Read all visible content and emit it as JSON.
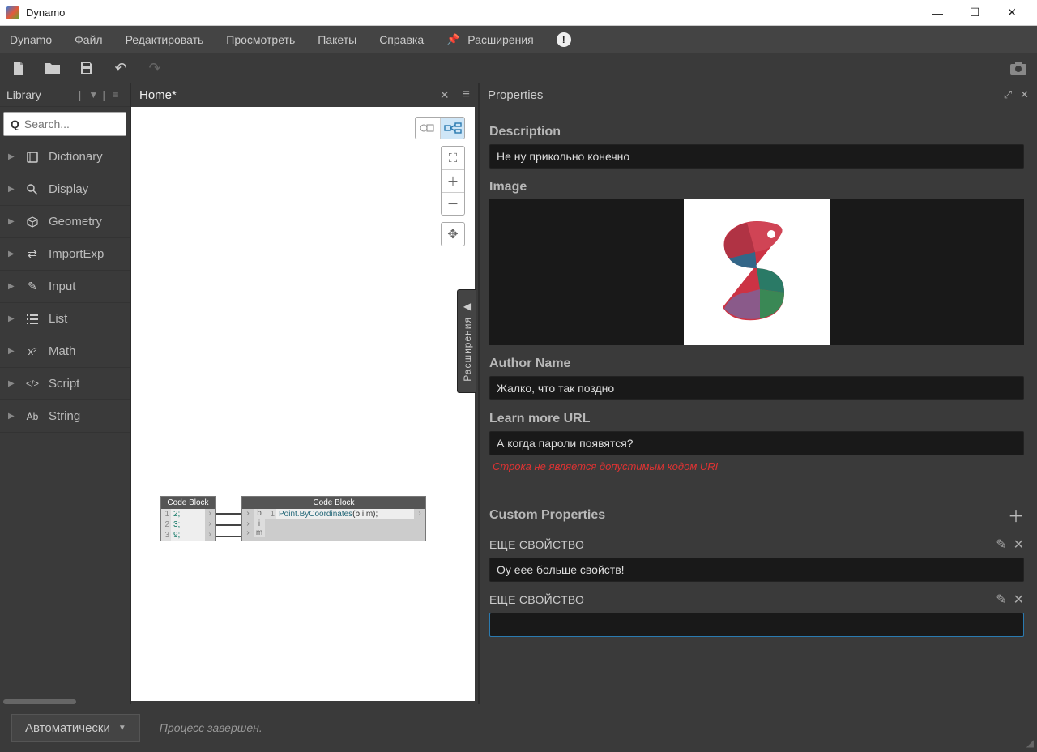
{
  "app_title": "Dynamo",
  "menus": [
    "Dynamo",
    "Файл",
    "Редактировать",
    "Просмотреть",
    "Пакеты",
    "Справка"
  ],
  "extensions_label": "Расширения",
  "library": {
    "header": "Library",
    "search_placeholder": "Search...",
    "items": [
      {
        "label": "Dictionary",
        "icon": "book"
      },
      {
        "label": "Display",
        "icon": "search"
      },
      {
        "label": "Geometry",
        "icon": "cube"
      },
      {
        "label": "ImportExp",
        "icon": "swap"
      },
      {
        "label": "Input",
        "icon": "pencil"
      },
      {
        "label": "List",
        "icon": "list"
      },
      {
        "label": "Math",
        "icon": "math"
      },
      {
        "label": "Script",
        "icon": "code"
      },
      {
        "label": "String",
        "icon": "ab"
      }
    ]
  },
  "canvas": {
    "tab_title": "Home*",
    "ext_tab": "Расширения",
    "node1": {
      "header": "Code Block",
      "rows": [
        {
          "ln": "1",
          "code": "2;"
        },
        {
          "ln": "2",
          "code": "3;"
        },
        {
          "ln": "3",
          "code": "9;"
        }
      ]
    },
    "node2": {
      "header": "Code Block",
      "inports": [
        "b",
        "i",
        "m"
      ],
      "ln": "1",
      "code_fn": "Point.ByCoordinates",
      "code_args": "(b,i,m);"
    }
  },
  "properties": {
    "title": "Properties",
    "description_label": "Description",
    "description_value": "Не ну прикольно конечно",
    "image_label": "Image",
    "author_label": "Author Name",
    "author_value": "Жалко, что так поздно",
    "url_label": "Learn more URL",
    "url_value": "А когда пароли появятся?",
    "url_error": "Строка не является допустимым кодом URI",
    "custom_label": "Custom Properties",
    "custom_props": [
      {
        "name": "ЕЩЕ СВОЙСТВО",
        "value": "Оу еее больше свойств!",
        "edit": true
      },
      {
        "name": "ЕЩЕ СВОЙСТВО",
        "value": "",
        "edit": true
      }
    ]
  },
  "status": {
    "run_mode": "Автоматически",
    "message": "Процесс завершен."
  }
}
